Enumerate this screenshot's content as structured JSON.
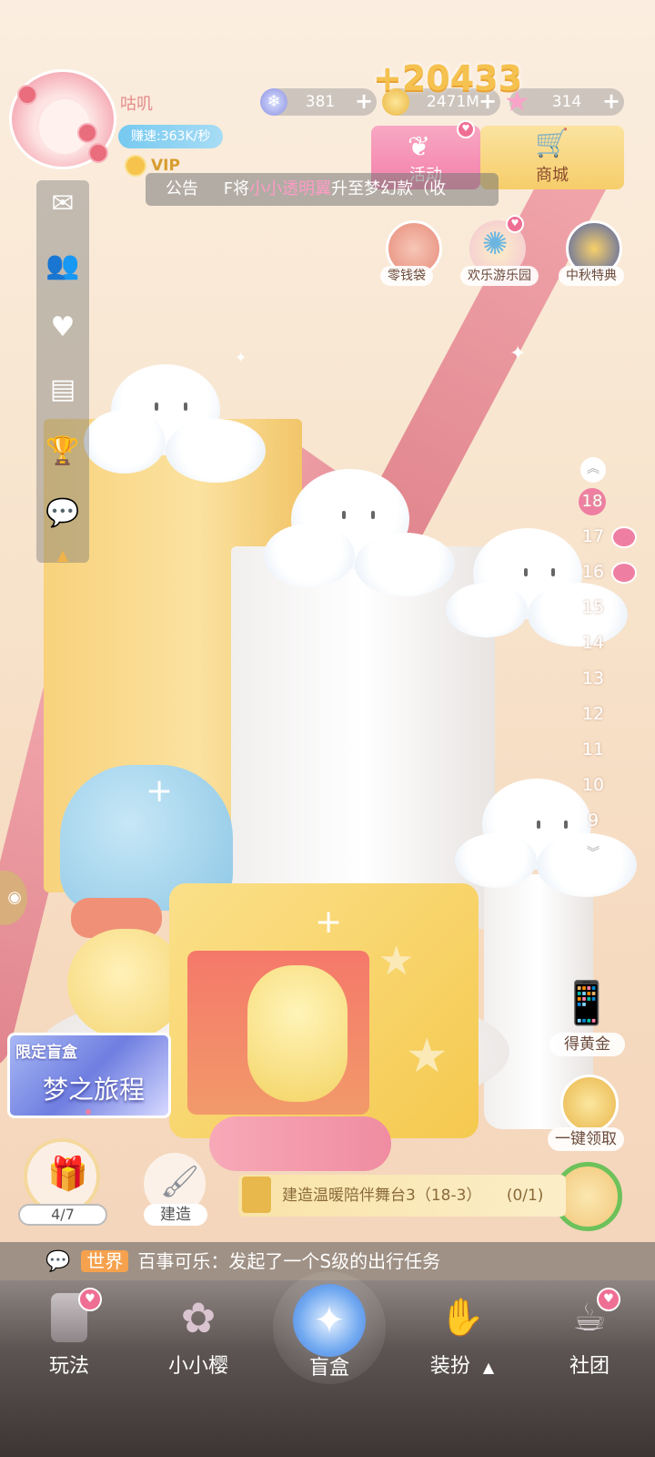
{
  "player": {
    "name": "咕叽",
    "earn_speed": "赚速:363K/秒",
    "vip": "VIP"
  },
  "resources": {
    "gems": "381",
    "gold": "2471M",
    "stars": "314",
    "gain_popup": "+20433"
  },
  "top_buttons": {
    "activity": "活动",
    "shop": "商城"
  },
  "announcement": {
    "label": "公告",
    "prefix": "F将",
    "highlight": "小小透明翼",
    "suffix": "升至梦幻款（收"
  },
  "quick_icons": [
    {
      "label": "零钱袋"
    },
    {
      "label": "欢乐游乐园"
    },
    {
      "label": "中秋特典"
    }
  ],
  "floors": {
    "current": "18",
    "list": [
      "17",
      "16",
      "15",
      "14",
      "13",
      "12",
      "11",
      "10",
      "9"
    ]
  },
  "side_widgets": {
    "get_gold": "得黄金",
    "collect_all": "一键领取"
  },
  "blind_box_banner": {
    "tag": "限定盲盒",
    "title": "梦之旅程"
  },
  "gift": {
    "progress": "4/7"
  },
  "build": {
    "label": "建造"
  },
  "task": {
    "text": "建造温暖陪伴舞台3（18-3）",
    "progress": "(0/1)"
  },
  "chat": {
    "channel": "世界",
    "message": "百事可乐：发起了一个S级的出行任务"
  },
  "nav": [
    {
      "label": "玩法"
    },
    {
      "label": "小小樱"
    },
    {
      "label": "盲盒"
    },
    {
      "label": "装扮",
      "arrow": "▲"
    },
    {
      "label": "社团"
    }
  ],
  "colors": {
    "accent_pink": "#ef7fa2",
    "gold": "#f5c14f",
    "speed_blue": "#76c9f0"
  }
}
